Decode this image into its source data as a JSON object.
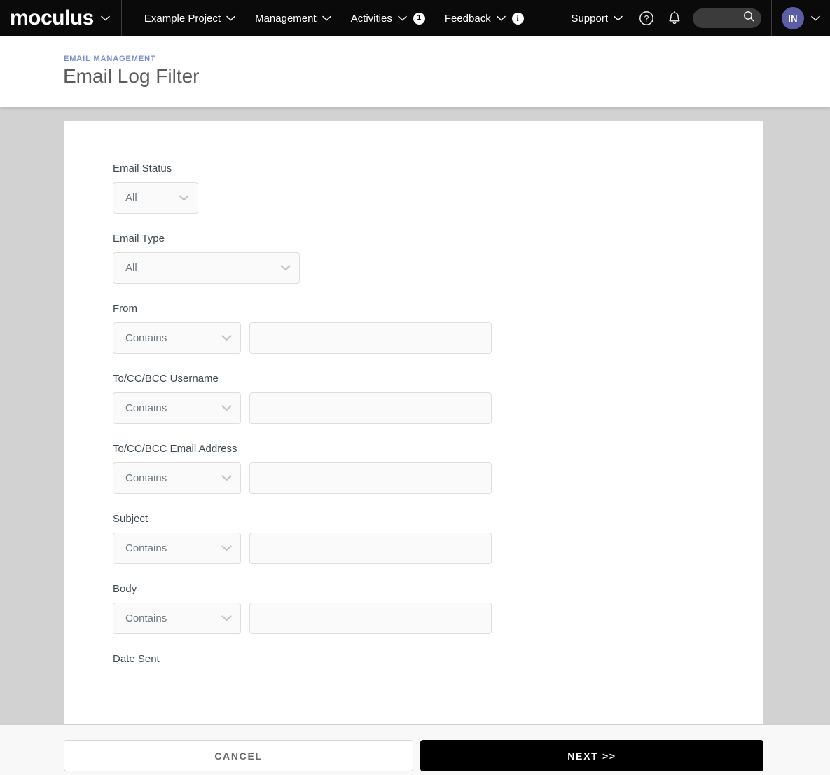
{
  "navbar": {
    "brand": "moculus",
    "items": [
      {
        "label": "Example Project",
        "caret": true,
        "badge": null,
        "info": false
      },
      {
        "label": "Management",
        "caret": true,
        "badge": null,
        "info": false
      },
      {
        "label": "Activities",
        "caret": true,
        "badge": "1",
        "info": false
      },
      {
        "label": "Feedback",
        "caret": true,
        "badge": null,
        "info": true
      }
    ],
    "support": {
      "label": "Support"
    },
    "icons": {
      "help": "help-circle-icon",
      "bell": "bell-icon",
      "search": "search-icon",
      "chevron": "chevron-down-icon"
    },
    "search": {
      "value": "",
      "placeholder": ""
    },
    "avatar": {
      "initials": "IN"
    }
  },
  "header": {
    "breadcrumb": "EMAIL MANAGEMENT",
    "title": "Email Log Filter"
  },
  "form": {
    "fields": [
      {
        "label": "Email Status",
        "type": "select",
        "width": "status",
        "value": "All",
        "options": [
          "All"
        ]
      },
      {
        "label": "Email Type",
        "type": "select",
        "width": "type",
        "value": "All",
        "options": [
          "All"
        ]
      },
      {
        "label": "From",
        "type": "operator-text",
        "operator": "Contains",
        "options": [
          "Contains"
        ],
        "value": "",
        "placeholder": ""
      },
      {
        "label": "To/CC/BCC Username",
        "type": "operator-text",
        "operator": "Contains",
        "options": [
          "Contains"
        ],
        "value": "",
        "placeholder": ""
      },
      {
        "label": "To/CC/BCC Email Address",
        "type": "operator-text",
        "operator": "Contains",
        "options": [
          "Contains"
        ],
        "value": "",
        "placeholder": ""
      },
      {
        "label": "Subject",
        "type": "operator-text",
        "operator": "Contains",
        "options": [
          "Contains"
        ],
        "value": "",
        "placeholder": ""
      },
      {
        "label": "Body",
        "type": "operator-text",
        "operator": "Contains",
        "options": [
          "Contains"
        ],
        "value": "",
        "placeholder": ""
      },
      {
        "label": "Date Sent",
        "type": "label-only"
      }
    ]
  },
  "footer": {
    "cancel_label": "CANCEL",
    "next_label": "NEXT >>"
  },
  "colors": {
    "nav_bg": "#0a0a0a",
    "breadcrumb": "#7b8dd1",
    "avatar": "#5b5ea6",
    "page_bg": "#d2d2d2",
    "card_bg": "#ffffff",
    "primary_button": "#000000"
  }
}
